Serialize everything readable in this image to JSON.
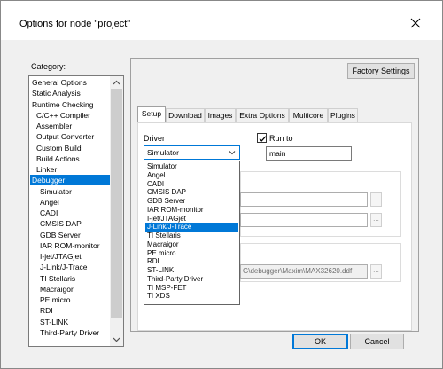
{
  "window": {
    "title": "Options for node \"project\""
  },
  "category": {
    "label": "Category:",
    "items": [
      {
        "label": "General Options"
      },
      {
        "label": "Static Analysis"
      },
      {
        "label": "Runtime Checking"
      },
      {
        "label": "C/C++ Compiler"
      },
      {
        "label": "Assembler"
      },
      {
        "label": "Output Converter"
      },
      {
        "label": "Custom Build"
      },
      {
        "label": "Build Actions"
      },
      {
        "label": "Linker"
      },
      {
        "label": "Debugger"
      },
      {
        "label": "Simulator"
      },
      {
        "label": "Angel"
      },
      {
        "label": "CADI"
      },
      {
        "label": "CMSIS DAP"
      },
      {
        "label": "GDB Server"
      },
      {
        "label": "IAR ROM-monitor"
      },
      {
        "label": "I-jet/JTAGjet"
      },
      {
        "label": "J-Link/J-Trace"
      },
      {
        "label": "TI Stellaris"
      },
      {
        "label": "Macraigor"
      },
      {
        "label": "PE micro"
      },
      {
        "label": "RDI"
      },
      {
        "label": "ST-LINK"
      },
      {
        "label": "Third-Party Driver"
      }
    ],
    "selected": "Debugger"
  },
  "factory_settings_label": "Factory Settings",
  "tabs": [
    {
      "label": "Setup"
    },
    {
      "label": "Download"
    },
    {
      "label": "Images"
    },
    {
      "label": "Extra Options"
    },
    {
      "label": "Multicore"
    },
    {
      "label": "Plugins"
    }
  ],
  "active_tab": "Setup",
  "driver": {
    "label": "Driver",
    "selected": "Simulator",
    "options": [
      {
        "label": "Simulator"
      },
      {
        "label": "Angel"
      },
      {
        "label": "CADI"
      },
      {
        "label": "CMSIS DAP"
      },
      {
        "label": "GDB Server"
      },
      {
        "label": "IAR ROM-monitor"
      },
      {
        "label": "I-jet/JTAGjet"
      },
      {
        "label": "J-Link/J-Trace"
      },
      {
        "label": "TI Stellaris"
      },
      {
        "label": "Macraigor"
      },
      {
        "label": "PE micro"
      },
      {
        "label": "RDI"
      },
      {
        "label": "ST-LINK"
      },
      {
        "label": "Third-Party Driver"
      },
      {
        "label": "TI MSP-FET"
      },
      {
        "label": "TI XDS"
      }
    ],
    "highlighted": "J-Link/J-Trace"
  },
  "run_to": {
    "label": "Run to",
    "checked": true,
    "value": "main"
  },
  "ddf_path": "G\\debugger\\Maxim\\MAX32620.ddf",
  "ellipsis_label": "...",
  "ok_label": "OK",
  "cancel_label": "Cancel",
  "colors": {
    "accent": "#0078d7",
    "dialog_bg": "#f0f0f0"
  }
}
